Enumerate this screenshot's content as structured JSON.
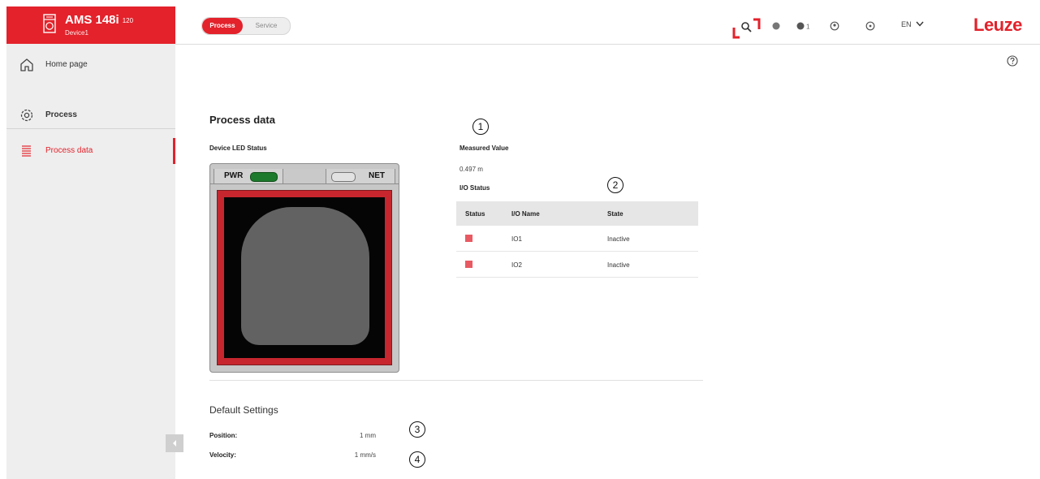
{
  "device": {
    "model": "AMS 148i",
    "range": "120",
    "name": "Device1"
  },
  "nav": {
    "home": "Home page",
    "process": "Process",
    "process_data": "Process data"
  },
  "tabs": {
    "process": "Process",
    "service": "Service"
  },
  "topbar": {
    "lang": "EN",
    "brand": "Leuze",
    "notif_count": "1",
    "icons": [
      "leuze-search-icon",
      "status-dot-icon",
      "notification-icon",
      "user-icon",
      "settings-icon",
      "chevron-down-icon",
      "help-icon"
    ]
  },
  "main": {
    "title": "Process data",
    "led_status_label": "Device LED Status",
    "led_pwr": "PWR",
    "led_net": "NET",
    "measured_label": "Measured Value",
    "measured_value": "0.497 m",
    "io_label": "I/O Status",
    "io_headers": [
      "Status",
      "I/O Name",
      "State"
    ],
    "io_rows": [
      {
        "name": "IO1",
        "state": "Inactive"
      },
      {
        "name": "IO2",
        "state": "Inactive"
      }
    ],
    "default_title": "Default Settings",
    "position_label": "Position:",
    "position_value": "1 mm",
    "velocity_label": "Velocity:",
    "velocity_value": "1 mm/s"
  },
  "callouts": [
    "1",
    "2",
    "3",
    "4"
  ],
  "colors": {
    "accent": "#e3222b",
    "led_on": "#1b7a2b",
    "io_inactive": "#e85a62"
  }
}
